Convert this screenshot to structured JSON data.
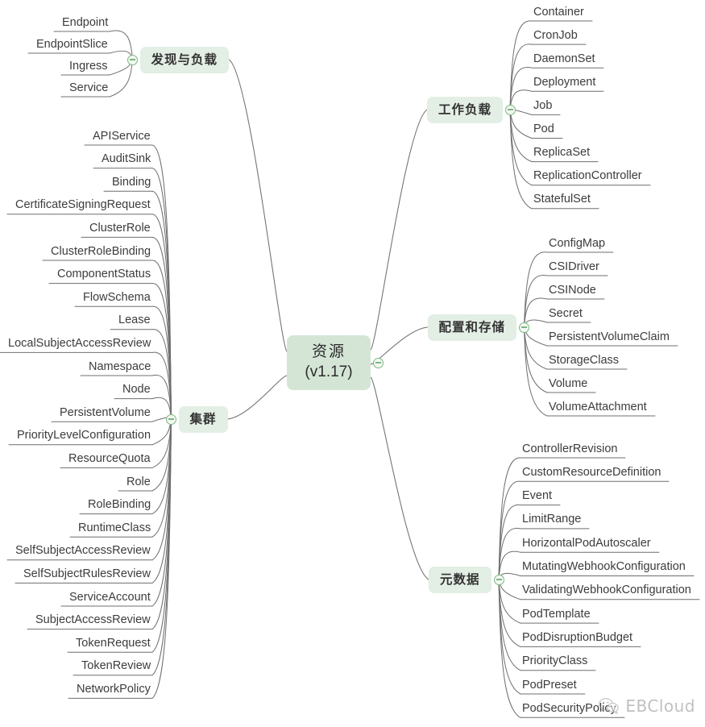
{
  "title": "Kubernetes 资源 (v1.17) 思维导图",
  "root": {
    "line1": "资源",
    "line2": "(v1.17)",
    "toggle": "collapse-toggle"
  },
  "colors": {
    "root_fill": "#d4e5d6",
    "branch_fill": "#e3eee4",
    "edge": "#6f6f6f",
    "leaf_text": "#3c3c3c",
    "toggle_stroke": "#7cb781",
    "background": "#ffffff"
  },
  "branches": [
    {
      "id": "discovery",
      "label": "发现与负载",
      "side": "left",
      "leaves": [
        "Endpoint",
        "EndpointSlice",
        "Ingress",
        "Service"
      ]
    },
    {
      "id": "cluster",
      "label": "集群",
      "side": "left",
      "leaves": [
        "APIService",
        "AuditSink",
        "Binding",
        "CertificateSigningRequest",
        "ClusterRole",
        "ClusterRoleBinding",
        "ComponentStatus",
        "FlowSchema",
        "Lease",
        "LocalSubjectAccessReview",
        "Namespace",
        "Node",
        "PersistentVolume",
        "PriorityLevelConfiguration",
        "ResourceQuota",
        "Role",
        "RoleBinding",
        "RuntimeClass",
        "SelfSubjectAccessReview",
        "SelfSubjectRulesReview",
        "ServiceAccount",
        "SubjectAccessReview",
        "TokenRequest",
        "TokenReview",
        "NetworkPolicy"
      ]
    },
    {
      "id": "workload",
      "label": "工作负载",
      "side": "right",
      "leaves": [
        "Container",
        "CronJob",
        "DaemonSet",
        "Deployment",
        "Job",
        "Pod",
        "ReplicaSet",
        "ReplicationController",
        "StatefulSet"
      ]
    },
    {
      "id": "config",
      "label": "配置和存储",
      "side": "right",
      "leaves": [
        "ConfigMap",
        "CSIDriver",
        "CSINode",
        "Secret",
        "PersistentVolumeClaim",
        "StorageClass",
        "Volume",
        "VolumeAttachment"
      ]
    },
    {
      "id": "metadata",
      "label": "元数据",
      "side": "right",
      "leaves": [
        "ControllerRevision",
        "CustomResourceDefinition",
        "Event",
        "LimitRange",
        "HorizontalPodAutoscaler",
        "MutatingWebhookConfiguration",
        "ValidatingWebhookConfiguration",
        "PodTemplate",
        "PodDisruptionBudget",
        "PriorityClass",
        "PodPreset",
        "PodSecurityPolicy"
      ]
    }
  ],
  "watermark": {
    "text": "EBCloud",
    "icon": "wechat-icon"
  }
}
